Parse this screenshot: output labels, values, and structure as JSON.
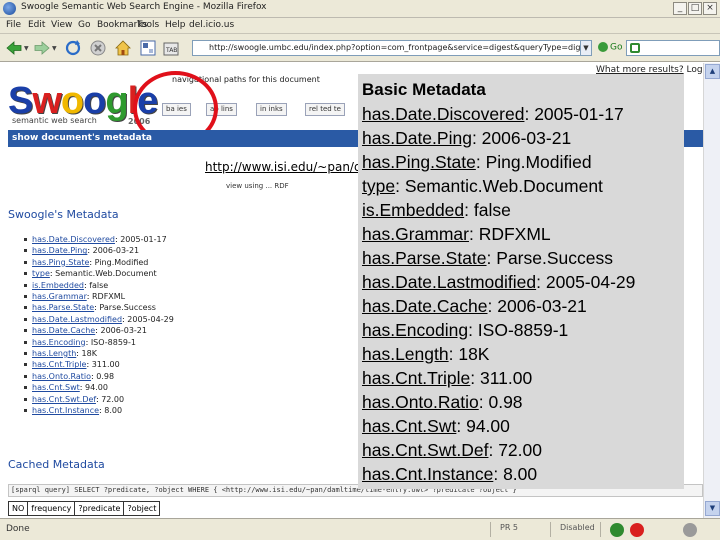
{
  "window": {
    "title": "Swoogle Semantic Web Search Engine - Mozilla Firefox",
    "controls": [
      "_",
      "□",
      "×"
    ]
  },
  "menu": [
    "File",
    "Edit",
    "View",
    "Go",
    "Bookmarks",
    "Tools",
    "Help",
    "del.icio.us"
  ],
  "navbar": {
    "url": "http://swoogle.umbc.edu/index.php?option=com_frontpage&service=digest&queryType=digest_swd&searchString=",
    "go_label": "Go",
    "icons": [
      "back-icon",
      "forward-icon",
      "reload-icon",
      "stop-icon",
      "home-icon",
      "bookmark-icon",
      "tab-icon"
    ]
  },
  "page": {
    "logo": {
      "letters": [
        "S",
        "w",
        "o",
        "o",
        "g",
        "l",
        "e"
      ],
      "colors": [
        "#1a3fa8",
        "#d9201f",
        "#f0b800",
        "#1a3fa8",
        "#2f9a2f",
        "#d9201f",
        "#1a3fa8"
      ],
      "subtitle": "semantic web search",
      "year": "2006"
    },
    "nav_paths_title": "navigational paths for this document",
    "nav_tabs": [
      "ba ies",
      "ab lins",
      "in inks",
      "rel ted te"
    ],
    "what_results": "What more results?",
    "login": "Login",
    "blue_bar": "show document's metadata",
    "doc_url": "http://www.isi.edu/~pan/dar",
    "rdf_button": "view using ... RDF",
    "swoogle_metadata_title": "Swoogle's Metadata",
    "metadata_rows": [
      {
        "key": "has.Date.Discovered",
        "value": "2005-01-17"
      },
      {
        "key": "has.Date.Ping",
        "value": "2006-03-21"
      },
      {
        "key": "has.Ping.State",
        "value": "Ping.Modified"
      },
      {
        "key": "type",
        "value": "Semantic.Web.Document"
      },
      {
        "key": "is.Embedded",
        "value": "false"
      },
      {
        "key": "has.Grammar",
        "value": "RDFXML"
      },
      {
        "key": "has.Parse.State",
        "value": "Parse.Success"
      },
      {
        "key": "has.Date.Lastmodified",
        "value": "2005-04-29"
      },
      {
        "key": "has.Date.Cache",
        "value": "2006-03-21"
      },
      {
        "key": "has.Encoding",
        "value": "ISO-8859-1"
      },
      {
        "key": "has.Length",
        "value": "18K"
      },
      {
        "key": "has.Cnt.Triple",
        "value": "311.00"
      },
      {
        "key": "has.Onto.Ratio",
        "value": "0.98"
      },
      {
        "key": "has.Cnt.Swt",
        "value": "94.00"
      },
      {
        "key": "has.Cnt.Swt.Def",
        "value": "72.00"
      },
      {
        "key": "has.Cnt.Instance",
        "value": "8.00"
      }
    ],
    "cached_title": "Cached Metadata",
    "sparql_query": "[sparql query] SELECT ?predicate, ?object WHERE { <http://www.isi.edu/~pan/damltime/time-entry.owl> ?predicate ?object }",
    "cached_table_headers": [
      "NO",
      "frequency",
      "?predicate",
      "?object"
    ]
  },
  "overlay": {
    "title": "Basic Metadata",
    "rows": [
      {
        "key": "has.Date.Discovered",
        "value": "2005-01-17"
      },
      {
        "key": "has.Date.Ping",
        "value": "2006-03-21"
      },
      {
        "key": "has.Ping.State",
        "value": "Ping.Modified"
      },
      {
        "key": "type",
        "value": "Semantic.Web.Document"
      },
      {
        "key": "is.Embedded",
        "value": "false"
      },
      {
        "key": "has.Grammar",
        "value": "RDFXML"
      },
      {
        "key": "has.Parse.State",
        "value": "Parse.Success"
      },
      {
        "key": "has.Date.Lastmodified",
        "value": "2005-04-29"
      },
      {
        "key": "has.Date.Cache",
        "value": "2006-03-21"
      },
      {
        "key": "has.Encoding",
        "value": "ISO-8859-1"
      },
      {
        "key": "has.Length",
        "value": "18K"
      },
      {
        "key": "has.Cnt.Triple",
        "value": "311.00"
      },
      {
        "key": "has.Onto.Ratio",
        "value": "0.98"
      },
      {
        "key": "has.Cnt.Swt",
        "value": "94.00"
      },
      {
        "key": "has.Cnt.Swt.Def",
        "value": "72.00"
      },
      {
        "key": "has.Cnt.Instance",
        "value": "8.00"
      }
    ]
  },
  "status": {
    "text": "Done",
    "page_rank": "PR 5",
    "offline": "Disabled"
  }
}
